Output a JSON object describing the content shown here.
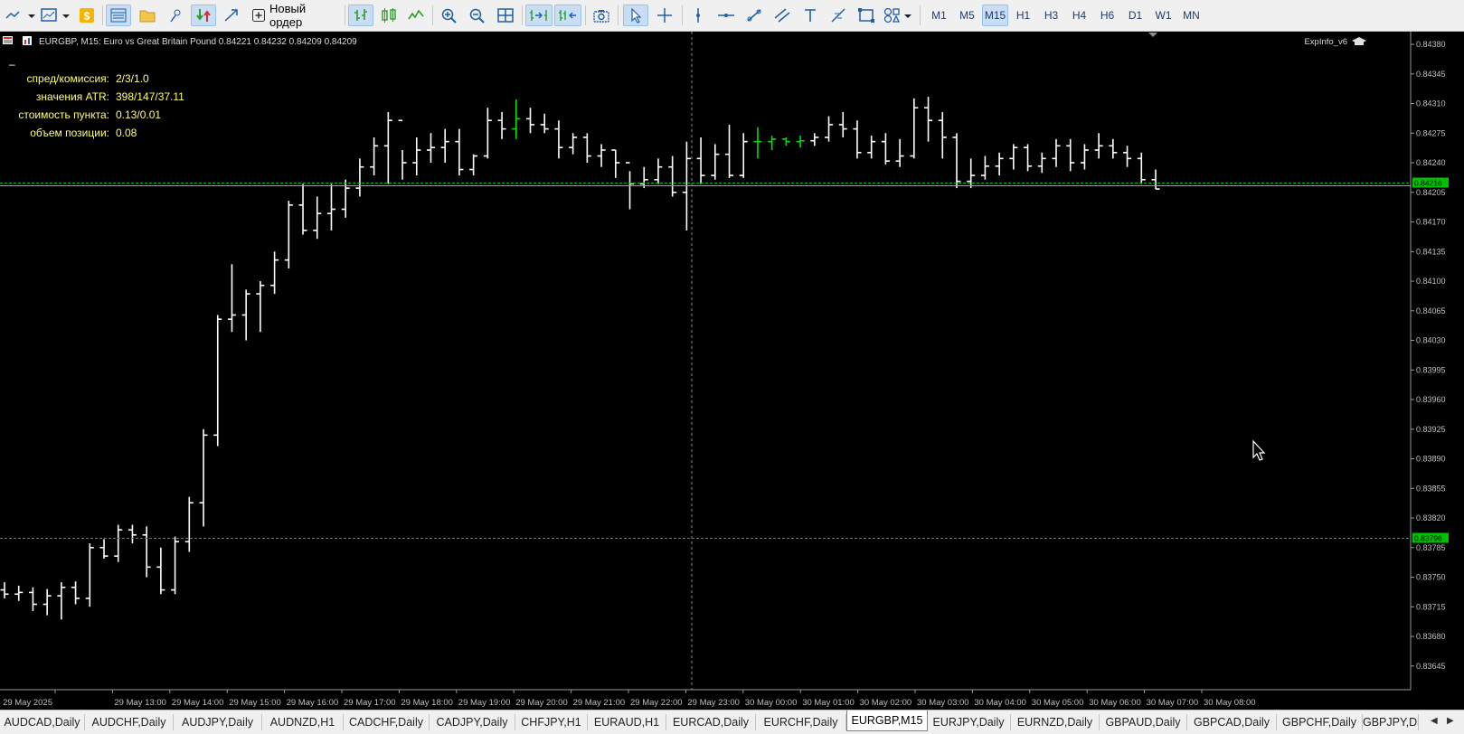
{
  "toolbar": {
    "new_order_label": "Новый ордер",
    "timeframes": [
      "M1",
      "M5",
      "M15",
      "H1",
      "H3",
      "H4",
      "H6",
      "D1",
      "W1",
      "MN"
    ],
    "active_timeframe": "M15"
  },
  "chart": {
    "header": "EURGBP, M15:  Euro vs Great Britain Pound   0.84221 0.84232 0.84209 0.84209",
    "expert_label": "ExpInfo_v6",
    "info_panel": [
      {
        "label": "спред/комиссия:",
        "value": "2/3/1.0"
      },
      {
        "label": "значения ATR:",
        "value": "398/147/37.11"
      },
      {
        "label": "стоимость пункта:",
        "value": "0.13/0.01"
      },
      {
        "label": "объем позиции:",
        "value": "0.08"
      }
    ],
    "bid_line_label": "0.84216",
    "level_line_label": "0.83796",
    "colors": {
      "background": "#000000",
      "bars": "#ffffff",
      "bull_highlight": "#00e000",
      "grid_line": "#00c000",
      "axis_text": "#bfbfbf"
    }
  },
  "chart_data": {
    "type": "ohlc",
    "symbol": "EURGBP",
    "timeframe": "M15",
    "y_ticks": [
      "0.84380",
      "0.84345",
      "0.84310",
      "0.84275",
      "0.84240",
      "0.84205",
      "0.84170",
      "0.84135",
      "0.84100",
      "0.84065",
      "0.84030",
      "0.83995",
      "0.83960",
      "0.83925",
      "0.83890",
      "0.83855",
      "0.83820",
      "0.83785",
      "0.83750",
      "0.83715",
      "0.83680",
      "0.83645"
    ],
    "x_ticks": [
      "29 May 2025",
      "29 May 13:00",
      "29 May 14:00",
      "29 May 15:00",
      "29 May 16:00",
      "29 May 17:00",
      "29 May 18:00",
      "29 May 19:00",
      "29 May 20:00",
      "29 May 21:00",
      "29 May 22:00",
      "29 May 23:00",
      "30 May 00:00",
      "30 May 01:00",
      "30 May 02:00",
      "30 May 03:00",
      "30 May 04:00",
      "30 May 05:00",
      "30 May 06:00",
      "30 May 07:00",
      "30 May 08:00"
    ],
    "ylim": [
      0.83617,
      0.84395
    ],
    "bid": 0.84216,
    "level": 0.83796,
    "green_bars": [
      36,
      53,
      54,
      55,
      56
    ],
    "bars": [
      [
        0.83735,
        0.83744,
        0.83725,
        0.8373
      ],
      [
        0.8373,
        0.8374,
        0.83722,
        0.83732
      ],
      [
        0.83732,
        0.83738,
        0.8371,
        0.83718
      ],
      [
        0.83718,
        0.83736,
        0.83705,
        0.83728
      ],
      [
        0.83728,
        0.83744,
        0.837,
        0.83738
      ],
      [
        0.83738,
        0.83745,
        0.83718,
        0.83725
      ],
      [
        0.83725,
        0.8379,
        0.83715,
        0.83785
      ],
      [
        0.83785,
        0.83795,
        0.83772,
        0.83775
      ],
      [
        0.83775,
        0.83812,
        0.83768,
        0.83806
      ],
      [
        0.83806,
        0.83812,
        0.8379,
        0.838
      ],
      [
        0.838,
        0.8381,
        0.8375,
        0.83762
      ],
      [
        0.83762,
        0.83785,
        0.8373,
        0.83735
      ],
      [
        0.83735,
        0.83798,
        0.8373,
        0.83792
      ],
      [
        0.83792,
        0.83845,
        0.8378,
        0.83838
      ],
      [
        0.83838,
        0.83925,
        0.8381,
        0.83918
      ],
      [
        0.83918,
        0.8406,
        0.83905,
        0.84055
      ],
      [
        0.84055,
        0.8412,
        0.8404,
        0.8406
      ],
      [
        0.8406,
        0.8409,
        0.8403,
        0.84085
      ],
      [
        0.84085,
        0.841,
        0.8404,
        0.84095
      ],
      [
        0.84095,
        0.84135,
        0.84085,
        0.84125
      ],
      [
        0.84125,
        0.84195,
        0.84115,
        0.8419
      ],
      [
        0.8419,
        0.84215,
        0.84155,
        0.8416
      ],
      [
        0.8416,
        0.842,
        0.8415,
        0.8418
      ],
      [
        0.8418,
        0.84215,
        0.8416,
        0.84185
      ],
      [
        0.84185,
        0.8422,
        0.84175,
        0.8421
      ],
      [
        0.8421,
        0.84245,
        0.842,
        0.84235
      ],
      [
        0.84235,
        0.8427,
        0.84225,
        0.8426
      ],
      [
        0.8426,
        0.843,
        0.84215,
        0.8429
      ],
      [
        0.8429,
        0.84255,
        0.8422,
        0.8424
      ],
      [
        0.8424,
        0.8427,
        0.84225,
        0.84255
      ],
      [
        0.84255,
        0.84275,
        0.8424,
        0.84258
      ],
      [
        0.84258,
        0.8428,
        0.8424,
        0.84265
      ],
      [
        0.84265,
        0.8428,
        0.84225,
        0.84232
      ],
      [
        0.84232,
        0.8425,
        0.84225,
        0.84248
      ],
      [
        0.84248,
        0.84305,
        0.84245,
        0.8429
      ],
      [
        0.8429,
        0.843,
        0.84268,
        0.8428
      ],
      [
        0.8428,
        0.84315,
        0.84268,
        0.84292
      ],
      [
        0.84292,
        0.84305,
        0.84275,
        0.84285
      ],
      [
        0.84285,
        0.84298,
        0.84275,
        0.8428
      ],
      [
        0.8428,
        0.8429,
        0.84245,
        0.84258
      ],
      [
        0.84258,
        0.84275,
        0.8425,
        0.8427
      ],
      [
        0.8427,
        0.84275,
        0.8424,
        0.84248
      ],
      [
        0.84248,
        0.84262,
        0.84235,
        0.84255
      ],
      [
        0.84255,
        0.84255,
        0.84222,
        0.8424
      ],
      [
        0.8424,
        0.8423,
        0.84185,
        0.84215
      ],
      [
        0.84215,
        0.84235,
        0.8421,
        0.8422
      ],
      [
        0.8422,
        0.84245,
        0.84215,
        0.84235
      ],
      [
        0.84235,
        0.84248,
        0.842,
        0.84205
      ],
      [
        0.84205,
        0.84265,
        0.8416,
        0.84245
      ],
      [
        0.84245,
        0.8427,
        0.84215,
        0.84225
      ],
      [
        0.84225,
        0.84262,
        0.8422,
        0.8425
      ],
      [
        0.8425,
        0.84285,
        0.84222,
        0.84225
      ],
      [
        0.84225,
        0.84275,
        0.84222,
        0.84265
      ],
      [
        0.84265,
        0.84282,
        0.84245,
        0.84265
      ],
      [
        0.84265,
        0.84272,
        0.84255,
        0.84268
      ],
      [
        0.84268,
        0.8427,
        0.8426,
        0.84265
      ],
      [
        0.84265,
        0.84272,
        0.84258,
        0.84266
      ],
      [
        0.84266,
        0.84275,
        0.8426,
        0.8427
      ],
      [
        0.8427,
        0.84295,
        0.84265,
        0.84285
      ],
      [
        0.84285,
        0.843,
        0.8427,
        0.8428
      ],
      [
        0.8428,
        0.8429,
        0.84245,
        0.84252
      ],
      [
        0.84252,
        0.84272,
        0.84245,
        0.84265
      ],
      [
        0.84265,
        0.84275,
        0.84238,
        0.84242
      ],
      [
        0.84242,
        0.84268,
        0.84235,
        0.84248
      ],
      [
        0.84248,
        0.84316,
        0.84245,
        0.84305
      ],
      [
        0.84305,
        0.84318,
        0.84265,
        0.8429
      ],
      [
        0.8429,
        0.843,
        0.84245,
        0.8427
      ],
      [
        0.8427,
        0.84275,
        0.8421,
        0.84218
      ],
      [
        0.84218,
        0.84245,
        0.8421,
        0.84225
      ],
      [
        0.84225,
        0.84248,
        0.8422,
        0.84236
      ],
      [
        0.84236,
        0.84252,
        0.84225,
        0.84245
      ],
      [
        0.84245,
        0.84262,
        0.84232,
        0.84258
      ],
      [
        0.84258,
        0.84262,
        0.8423,
        0.84236
      ],
      [
        0.84236,
        0.84252,
        0.84228,
        0.84245
      ],
      [
        0.84245,
        0.84268,
        0.84235,
        0.8426
      ],
      [
        0.8426,
        0.84268,
        0.8423,
        0.8424
      ],
      [
        0.8424,
        0.84262,
        0.84232,
        0.84255
      ],
      [
        0.84255,
        0.84275,
        0.84245,
        0.8426
      ],
      [
        0.8426,
        0.84268,
        0.84245,
        0.84252
      ],
      [
        0.84252,
        0.8426,
        0.84235,
        0.84245
      ],
      [
        0.84245,
        0.84252,
        0.84215,
        0.8422
      ],
      [
        0.8422,
        0.84232,
        0.84209,
        0.84209
      ]
    ]
  },
  "tabs": [
    "AUDCAD,Daily",
    "AUDCHF,Daily",
    "AUDJPY,Daily",
    "AUDNZD,H1",
    "CADCHF,Daily",
    "CADJPY,Daily",
    "CHFJPY,H1",
    "EURAUD,H1",
    "EURCAD,Daily",
    "EURCHF,Daily",
    "EURGBP,M15",
    "EURJPY,Daily",
    "EURNZD,Daily",
    "GBPAUD,Daily",
    "GBPCAD,Daily",
    "GBPCHF,Daily",
    "GBPJPY,Daily"
  ],
  "active_tab": "EURGBP,M15"
}
